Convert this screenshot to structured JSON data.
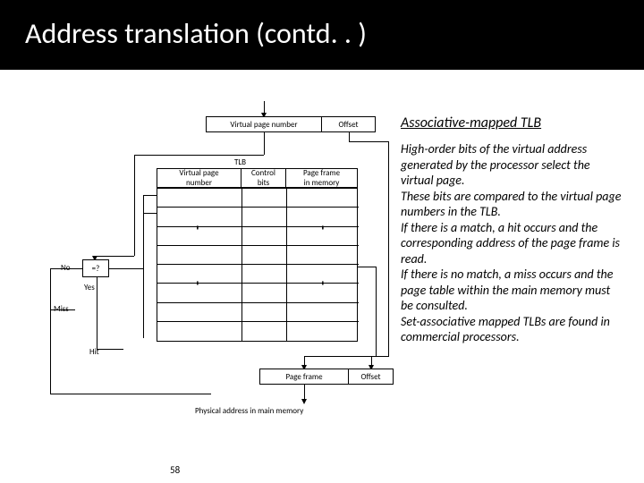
{
  "title": "Address translation (contd. . )",
  "top_va": {
    "vpn": "Virtual page number",
    "offset": "Offset"
  },
  "tlb": {
    "label": "TLB",
    "headers": {
      "vpn": "Virtual page\nnumber",
      "ctrl": "Control\nbits",
      "pf": "Page frame\nin memory"
    },
    "vdots": ". . ."
  },
  "compare": {
    "eq": "=?",
    "no": "No",
    "yes": "Yes",
    "miss": "Miss",
    "hit": "Hit"
  },
  "bottom": {
    "pf": "Page frame",
    "offset": "Offset",
    "phys": "Physical address in main memory"
  },
  "right": {
    "heading": "Associative-mapped TLB",
    "body": "High-order bits of the virtual address generated by the processor select the virtual page.\nThese bits are compared to the virtual page numbers in the TLB.\nIf there is a match, a hit occurs and the corresponding address of the page frame is read.\nIf there is no match, a miss occurs and the page table within the main memory must be consulted.\nSet-associative mapped TLBs are found in commercial processors."
  },
  "page_number": "58"
}
